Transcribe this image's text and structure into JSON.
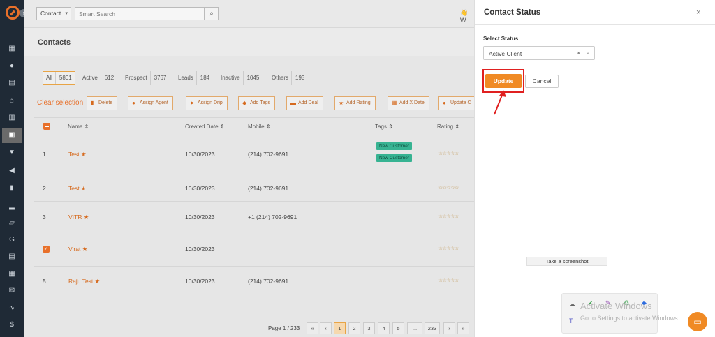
{
  "topbar": {
    "contact_select": "Contact",
    "search_placeholder": "Smart Search",
    "user_hint": "W"
  },
  "page": {
    "title": "Contacts"
  },
  "filters": [
    {
      "label": "All",
      "count": "5801"
    },
    {
      "label": "Active",
      "count": "612"
    },
    {
      "label": "Prospect",
      "count": "3767"
    },
    {
      "label": "Leads",
      "count": "184"
    },
    {
      "label": "Inactive",
      "count": "1045"
    },
    {
      "label": "Others",
      "count": "193"
    }
  ],
  "actions": {
    "clear_selection": "Clear selection",
    "buttons": [
      "Delete",
      "Assign Agent",
      "Assign Drip",
      "Add Tags",
      "Add Deal",
      "Add Rating",
      "Add X Date",
      "Update C"
    ]
  },
  "table": {
    "headers": [
      "Name",
      "Created Date",
      "Mobile",
      "Tags",
      "Rating"
    ],
    "sort_icon": "⇕",
    "rows": [
      {
        "index": "1",
        "name": "Test",
        "date": "10/30/2023",
        "mobile": "(214) 702-9691",
        "tags": [
          "New Customer",
          "New Customer"
        ],
        "rating": "☆☆☆☆☆"
      },
      {
        "index": "2",
        "name": "Test",
        "date": "10/30/2023",
        "mobile": "(214) 702-9691",
        "tags": [],
        "rating": "☆☆☆☆☆"
      },
      {
        "index": "3",
        "name": "VITR",
        "date": "10/30/2023",
        "mobile": "+1 (214) 702-9691",
        "tags": [],
        "rating": "☆☆☆☆☆"
      },
      {
        "index": "",
        "name": "Virat",
        "date": "10/30/2023",
        "mobile": "",
        "tags": [],
        "rating": "☆☆☆☆☆",
        "checked": true
      },
      {
        "index": "5",
        "name": "Raju Test",
        "date": "10/30/2023",
        "mobile": "(214) 702-9691",
        "tags": [],
        "rating": "☆☆☆☆☆"
      }
    ]
  },
  "pagination": {
    "label": "Page 1 / 233",
    "pages": [
      "«",
      "‹",
      "1",
      "2",
      "3",
      "4",
      "5",
      "...",
      "233",
      "›",
      "»"
    ],
    "current": "1"
  },
  "modal": {
    "title": "Contact Status",
    "close": "×",
    "select_label": "Select Status",
    "select_value": "Active Client",
    "update_label": "Update",
    "cancel_label": "Cancel"
  },
  "overlay": {
    "screenshot_tip": "Take a screenshot",
    "windows_title": "Activate Windows",
    "windows_sub": "Go to Settings to activate Windows."
  },
  "colors": {
    "accent": "#f08a24",
    "sidebar": "#1f2a36",
    "tag": "#37b392",
    "highlight": "#e02020"
  },
  "icons": [
    "logo-icon",
    "dashboard-icon",
    "users-icon",
    "documents-icon",
    "bank-icon",
    "contacts-icon",
    "funnel-icon",
    "megaphone-icon",
    "notes-icon",
    "chart-icon",
    "folder-icon",
    "google-icon",
    "calculator-icon",
    "calendar-icon",
    "mail-icon",
    "signature-icon",
    "dollar-icon",
    "search-icon",
    "close-icon",
    "chat-icon"
  ]
}
